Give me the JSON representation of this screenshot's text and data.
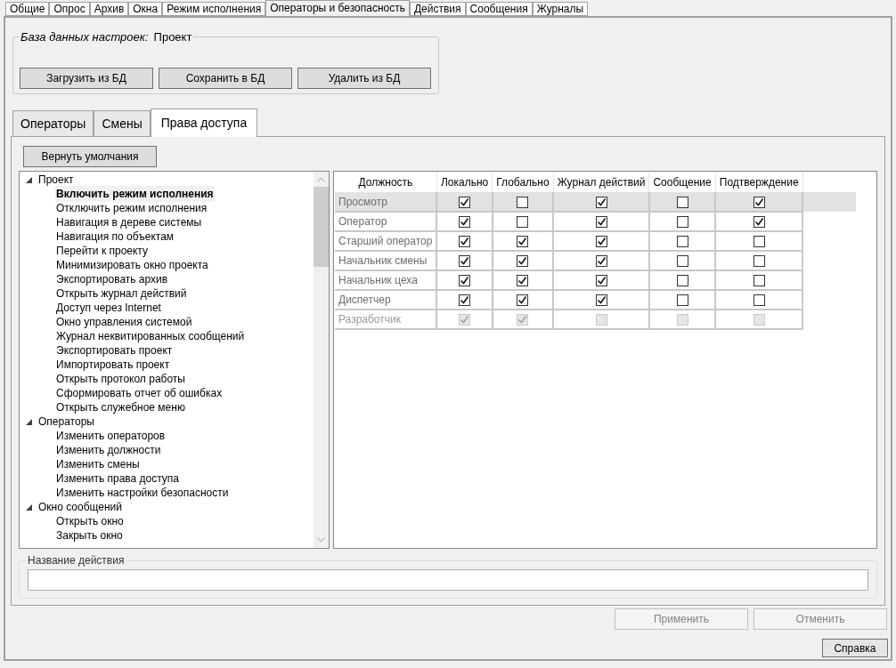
{
  "top_tabs": [
    {
      "label": "Общие",
      "selected": false
    },
    {
      "label": "Опрос",
      "selected": false
    },
    {
      "label": "Архив",
      "selected": false
    },
    {
      "label": "Окна",
      "selected": false
    },
    {
      "label": "Режим исполнения",
      "selected": false
    },
    {
      "label": "Операторы и безопасность",
      "selected": true
    },
    {
      "label": "Действия",
      "selected": false
    },
    {
      "label": "Сообщения",
      "selected": false
    },
    {
      "label": "Журналы",
      "selected": false
    }
  ],
  "settings_db": {
    "label": "База данных настроек:",
    "value": "Проект",
    "buttons": [
      "Загрузить из БД",
      "Сохранить в БД",
      "Удалить из БД"
    ]
  },
  "inner_tabs": [
    {
      "label": "Операторы",
      "selected": false
    },
    {
      "label": "Смены",
      "selected": false
    },
    {
      "label": "Права доступа",
      "selected": true
    }
  ],
  "reset_button": "Вернуть умолчания",
  "tree": [
    {
      "label": "Проект",
      "expanded": true,
      "children": [
        {
          "label": "Включить режим исполнения",
          "selected": true
        },
        {
          "label": "Отключить режим исполнения",
          "selected": false
        },
        {
          "label": "Навигация в дереве системы",
          "selected": false
        },
        {
          "label": "Навигация по объектам",
          "selected": false
        },
        {
          "label": "Перейти к проекту",
          "selected": false
        },
        {
          "label": "Минимизировать окно проекта",
          "selected": false
        },
        {
          "label": "Экспортировать архив",
          "selected": false
        },
        {
          "label": "Открыть журнал действий",
          "selected": false
        },
        {
          "label": "Доступ через Internet",
          "selected": false
        },
        {
          "label": "Окно управления системой",
          "selected": false
        },
        {
          "label": "Журнал неквитированных сообщений",
          "selected": false
        },
        {
          "label": "Экспортировать проект",
          "selected": false
        },
        {
          "label": "Импортировать проект",
          "selected": false
        },
        {
          "label": "Открыть протокол работы",
          "selected": false
        },
        {
          "label": "Сформировать отчет об ошибках",
          "selected": false
        },
        {
          "label": "Открыть служебное меню",
          "selected": false
        }
      ]
    },
    {
      "label": "Операторы",
      "expanded": true,
      "children": [
        {
          "label": "Изменить операторов",
          "selected": false
        },
        {
          "label": "Изменить должности",
          "selected": false
        },
        {
          "label": "Изменить смены",
          "selected": false
        },
        {
          "label": "Изменить права доступа",
          "selected": false
        },
        {
          "label": "Изменить настройки безопасности",
          "selected": false
        }
      ]
    },
    {
      "label": "Окно сообщений",
      "expanded": true,
      "children": [
        {
          "label": "Открыть окно",
          "selected": false
        },
        {
          "label": "Закрыть окно",
          "selected": false
        }
      ]
    }
  ],
  "grid": {
    "columns": [
      "Должность",
      "Локально",
      "Глобально",
      "Журнал действий",
      "Сообщение",
      "Подтверждение"
    ],
    "rows": [
      {
        "role": "Просмотр",
        "selected": true,
        "disabled": false,
        "values": [
          true,
          false,
          true,
          false,
          true
        ]
      },
      {
        "role": "Оператор",
        "selected": false,
        "disabled": false,
        "values": [
          true,
          false,
          true,
          false,
          true
        ]
      },
      {
        "role": "Старший оператор",
        "selected": false,
        "disabled": false,
        "values": [
          true,
          true,
          true,
          false,
          false
        ]
      },
      {
        "role": "Начальник смены",
        "selected": false,
        "disabled": false,
        "values": [
          true,
          true,
          true,
          false,
          false
        ]
      },
      {
        "role": "Начальник цеха",
        "selected": false,
        "disabled": false,
        "values": [
          true,
          true,
          true,
          false,
          false
        ]
      },
      {
        "role": "Диспетчер",
        "selected": false,
        "disabled": false,
        "values": [
          true,
          true,
          true,
          false,
          false
        ]
      },
      {
        "role": "Разработчик",
        "selected": false,
        "disabled": true,
        "values": [
          true,
          true,
          false,
          false,
          false
        ]
      }
    ]
  },
  "action_name": {
    "label": "Название действия"
  },
  "buttons": [
    {
      "label": "Применить",
      "disabled": true
    },
    {
      "label": "Отменить",
      "disabled": true
    }
  ],
  "help_button": "Справка"
}
